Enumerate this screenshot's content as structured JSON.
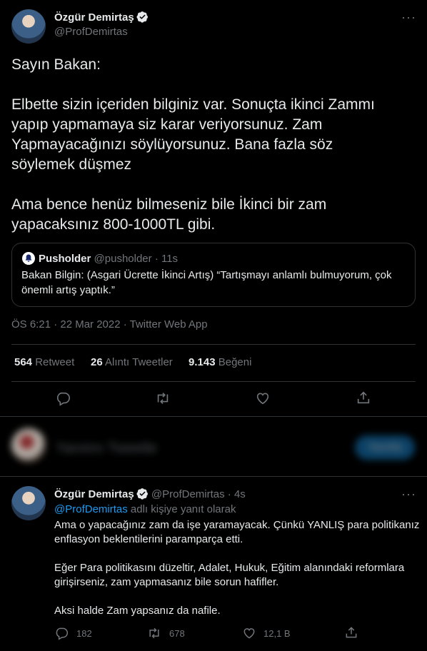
{
  "tweet": {
    "author_name": "Özgür Demirtaş",
    "author_handle": "@ProfDemirtas",
    "more": "···",
    "line1": "Sayın Bakan:",
    "para2_l1": "Elbette sizin içeriden bilginiz var. Sonuçta ikinci Zammı",
    "para2_l2": "yapıp yapmamaya siz karar veriyorsunuz. Zam",
    "para2_l3": "Yapmayacağınızı söylüyorsunuz. Bana fazla söz",
    "para2_l4": "söylemek düşmez",
    "para3_l1": "Ama bence henüz bilmeseniz bile İkinci bir zam",
    "para3_l2": "yapacaksınız 800-1000TL gibi.",
    "quote": {
      "name": "Pusholder",
      "handle": "@pusholder",
      "time": "· 11s",
      "text_l1": "Bakan Bilgin: (Asgari Ücrette İkinci Artış) “Tartışmayı anlamlı bulmuyorum, çok",
      "text_l2": "önemli artış yaptık.”"
    },
    "timestamp": "ÖS 6:21 · 22 Mar 2022 · Twitter Web App",
    "stats": {
      "retweets_count": "564",
      "retweets_label": "Retweet",
      "quotes_count": "26",
      "quotes_label": "Alıntı Tweetler",
      "likes_count": "9.143",
      "likes_label": "Beğeni"
    }
  },
  "reply_box": {
    "placeholder": "Yanıtını Tweetle",
    "button": "Yanıtla"
  },
  "reply": {
    "author_name": "Özgür Demirtaş",
    "author_handle": "@ProfDemirtas",
    "time": "· 4s",
    "more": "···",
    "replying_prefix": "@ProfDemirtas",
    "replying_suffix": " adlı kişiye yanıt olarak",
    "p1_l1": "Ama o yapacağınız zam da işe yaramayacak. Çünkü YANLIŞ para politikanız",
    "p1_l2": "enflasyon beklentilerini paramparça etti.",
    "p2_l1": "Eğer Para politikasını düzeltir, Adalet, Hukuk, Eğitim alanındaki reformlara",
    "p2_l2": "girişirseniz, zam yapmasanız bile sorun hafifler.",
    "p3": "Aksi halde Zam yapsanız da nafile.",
    "actions": {
      "replies": "182",
      "retweets": "678",
      "likes": "12,1 B"
    }
  },
  "colors": {
    "background": "#000000",
    "accent": "#1d9bf0",
    "text": "#e7e9ea",
    "muted": "#71767b",
    "border": "#2f3336"
  }
}
